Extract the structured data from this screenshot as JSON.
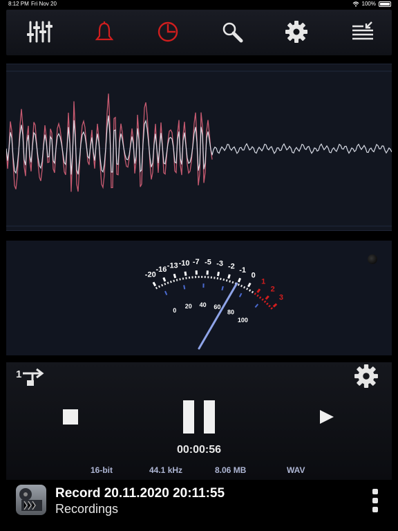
{
  "status_bar": {
    "time": "8:12 PM",
    "date": "Fri Nov 20",
    "battery": "100%"
  },
  "toolbar": {
    "icons": [
      "mixer-icon",
      "bell-icon",
      "timer-icon",
      "search-icon",
      "gear-icon",
      "playlist-icon"
    ],
    "colors": {
      "normal": "#e6e6e6",
      "active": "#d01e1e"
    }
  },
  "vu_meter": {
    "db_scale": [
      "-20",
      "-16",
      "-13",
      "-10",
      "-7",
      "-5",
      "-3",
      "-2",
      "-1",
      "0",
      "1",
      "2",
      "3"
    ],
    "percent_scale": [
      "0",
      "20",
      "40",
      "60",
      "80",
      "100"
    ]
  },
  "transport": {
    "elapsed": "00:00:56",
    "bit_depth": "16-bit",
    "sample_rate": "44.1 kHz",
    "file_size": "8.06 MB",
    "format": "WAV"
  },
  "recording": {
    "title": "Record 20.11.2020 20:11:55",
    "folder": "Recordings"
  }
}
